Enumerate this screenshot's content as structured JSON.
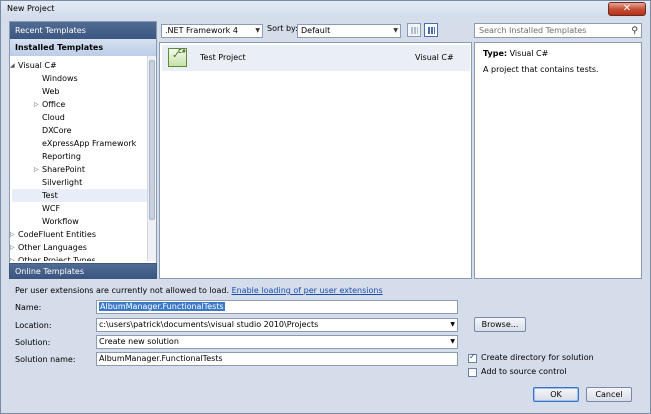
{
  "window": {
    "title": "New Project",
    "close_glyph": "✕"
  },
  "left_panel": {
    "recent_templates": "Recent Templates",
    "installed_templates": "Installed Templates",
    "online_templates": "Online Templates",
    "tree": [
      {
        "label": "Visual C#",
        "level": 0,
        "expanded": true
      },
      {
        "label": "Windows",
        "level": 1
      },
      {
        "label": "Web",
        "level": 1
      },
      {
        "label": "Office",
        "level": 1,
        "collapsed": true
      },
      {
        "label": "Cloud",
        "level": 1
      },
      {
        "label": "DXCore",
        "level": 1
      },
      {
        "label": "eXpressApp Framework",
        "level": 1
      },
      {
        "label": "Reporting",
        "level": 1
      },
      {
        "label": "SharePoint",
        "level": 1,
        "collapsed": true
      },
      {
        "label": "Silverlight",
        "level": 1
      },
      {
        "label": "Test",
        "level": 1,
        "selected": true
      },
      {
        "label": "WCF",
        "level": 1
      },
      {
        "label": "Workflow",
        "level": 1
      },
      {
        "label": "CodeFluent Entities",
        "level": 0,
        "collapsed": true
      },
      {
        "label": "Other Languages",
        "level": 0,
        "collapsed": true
      },
      {
        "label": "Other Project Types",
        "level": 0,
        "collapsed": true
      }
    ]
  },
  "toolbar": {
    "framework": ".NET Framework 4",
    "sort_by_label": "Sort by:",
    "sort_by_value": "Default",
    "search_placeholder": "Search Installed Templates"
  },
  "templates": [
    {
      "name": "Test Project",
      "language": "Visual C#",
      "icon": "test-project-icon"
    }
  ],
  "details": {
    "type_label": "Type:",
    "type_value": "Visual C#",
    "description": "A project that contains tests."
  },
  "form": {
    "warning_text": "Per user extensions are currently not allowed to load.",
    "warning_link": "Enable loading of per user extensions",
    "name_label": "Name:",
    "name_value": "AlbumManager.FunctionalTests",
    "location_label": "Location:",
    "location_value": "c:\\users\\patrick\\documents\\visual studio 2010\\Projects",
    "browse_label": "Browse...",
    "solution_label": "Solution:",
    "solution_value": "Create new solution",
    "solution_name_label": "Solution name:",
    "solution_name_value": "AlbumManager.FunctionalTests",
    "create_directory_label": "Create directory for solution",
    "create_directory_checked": true,
    "source_control_label": "Add to source control",
    "source_control_checked": false
  },
  "buttons": {
    "ok": "OK",
    "cancel": "Cancel"
  }
}
